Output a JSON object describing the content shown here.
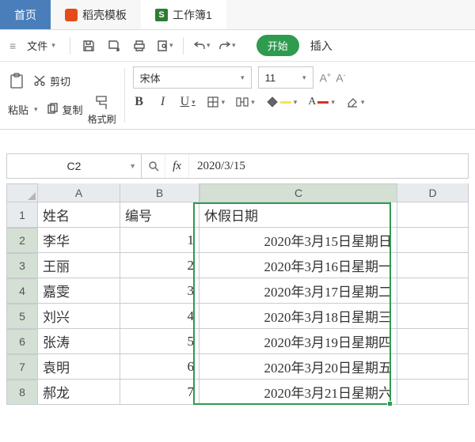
{
  "tabs": {
    "home": "首页",
    "templates": "稻壳模板",
    "workbook": "工作簿1"
  },
  "menu": {
    "file": "文件",
    "start_pill": "开始",
    "insert": "插入"
  },
  "clipboard": {
    "paste": "粘贴",
    "cut": "剪切",
    "copy": "复制",
    "format_painter": "格式刷"
  },
  "font": {
    "name": "宋体",
    "size": "11"
  },
  "formula_bar": {
    "cell_ref": "C2",
    "value": "2020/3/15"
  },
  "columns": [
    "A",
    "B",
    "C",
    "D"
  ],
  "headers": {
    "A": "姓名",
    "B": "编号",
    "C": "休假日期"
  },
  "rows": [
    {
      "n": "1"
    },
    {
      "n": "2",
      "A": "李华",
      "B": "1",
      "C": "2020年3月15日星期日"
    },
    {
      "n": "3",
      "A": "王丽",
      "B": "2",
      "C": "2020年3月16日星期一"
    },
    {
      "n": "4",
      "A": "嘉雯",
      "B": "3",
      "C": "2020年3月17日星期二"
    },
    {
      "n": "5",
      "A": "刘兴",
      "B": "4",
      "C": "2020年3月18日星期三"
    },
    {
      "n": "6",
      "A": "张涛",
      "B": "5",
      "C": "2020年3月19日星期四"
    },
    {
      "n": "7",
      "A": "袁明",
      "B": "6",
      "C": "2020年3月20日星期五"
    },
    {
      "n": "8",
      "A": "郝龙",
      "B": "7",
      "C": "2020年3月21日星期六"
    }
  ]
}
